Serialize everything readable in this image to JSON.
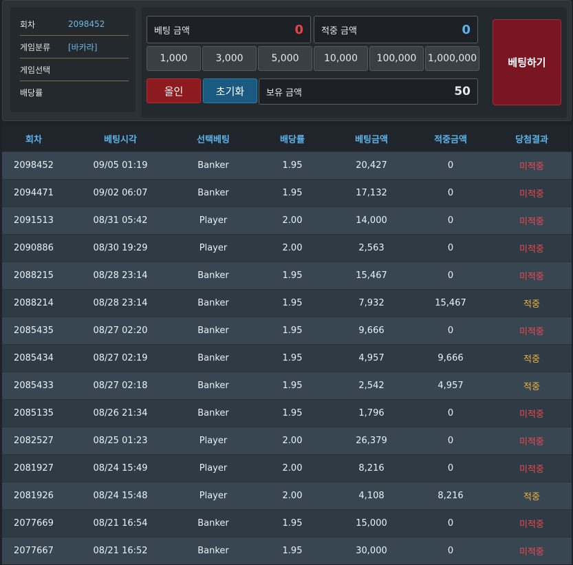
{
  "info": {
    "round_label": "회차",
    "round_value": "2098452",
    "category_label": "게임분류",
    "category_value": "[바카라]",
    "select_label": "게임선택",
    "select_value": "",
    "odds_label": "배당률",
    "odds_value": ""
  },
  "bet": {
    "amount_label": "베팅 금액",
    "amount_value": "0",
    "win_label": "적중 금액",
    "win_value": "0",
    "chips": [
      "1,000",
      "3,000",
      "5,000",
      "10,000",
      "100,000",
      "1,000,000"
    ],
    "allin_label": "올인",
    "reset_label": "초기화",
    "balance_label": "보유 금액",
    "balance_value": "50",
    "submit_label": "베팅하기"
  },
  "colors": {
    "amount": "#e8434a",
    "win": "#5db3ea",
    "miss": "#f0474e",
    "hit": "#f0b43c"
  },
  "table": {
    "headers": [
      "회차",
      "베팅시각",
      "선택베팅",
      "배당률",
      "베팅금액",
      "적중금액",
      "당첨결과"
    ],
    "rows": [
      [
        "2098452",
        "09/05 01:19",
        "Banker",
        "1.95",
        "20,427",
        "0",
        "미적중"
      ],
      [
        "2094471",
        "09/02 06:07",
        "Banker",
        "1.95",
        "17,132",
        "0",
        "미적중"
      ],
      [
        "2091513",
        "08/31 05:42",
        "Player",
        "2.00",
        "14,000",
        "0",
        "미적중"
      ],
      [
        "2090886",
        "08/30 19:29",
        "Player",
        "2.00",
        "2,563",
        "0",
        "미적중"
      ],
      [
        "2088215",
        "08/28 23:14",
        "Banker",
        "1.95",
        "15,467",
        "0",
        "미적중"
      ],
      [
        "2088214",
        "08/28 23:14",
        "Banker",
        "1.95",
        "7,932",
        "15,467",
        "적중"
      ],
      [
        "2085435",
        "08/27 02:20",
        "Banker",
        "1.95",
        "9,666",
        "0",
        "미적중"
      ],
      [
        "2085434",
        "08/27 02:19",
        "Banker",
        "1.95",
        "4,957",
        "9,666",
        "적중"
      ],
      [
        "2085433",
        "08/27 02:18",
        "Banker",
        "1.95",
        "2,542",
        "4,957",
        "적중"
      ],
      [
        "2085135",
        "08/26 21:34",
        "Banker",
        "1.95",
        "1,796",
        "0",
        "미적중"
      ],
      [
        "2082527",
        "08/25 01:23",
        "Player",
        "2.00",
        "26,379",
        "0",
        "미적중"
      ],
      [
        "2081927",
        "08/24 15:49",
        "Player",
        "2.00",
        "8,216",
        "0",
        "미적중"
      ],
      [
        "2081926",
        "08/24 15:48",
        "Player",
        "2.00",
        "4,108",
        "8,216",
        "적중"
      ],
      [
        "2077669",
        "08/21 16:54",
        "Banker",
        "1.95",
        "15,000",
        "0",
        "미적중"
      ],
      [
        "2077667",
        "08/21 16:52",
        "Banker",
        "1.95",
        "30,000",
        "0",
        "미적중"
      ]
    ]
  }
}
